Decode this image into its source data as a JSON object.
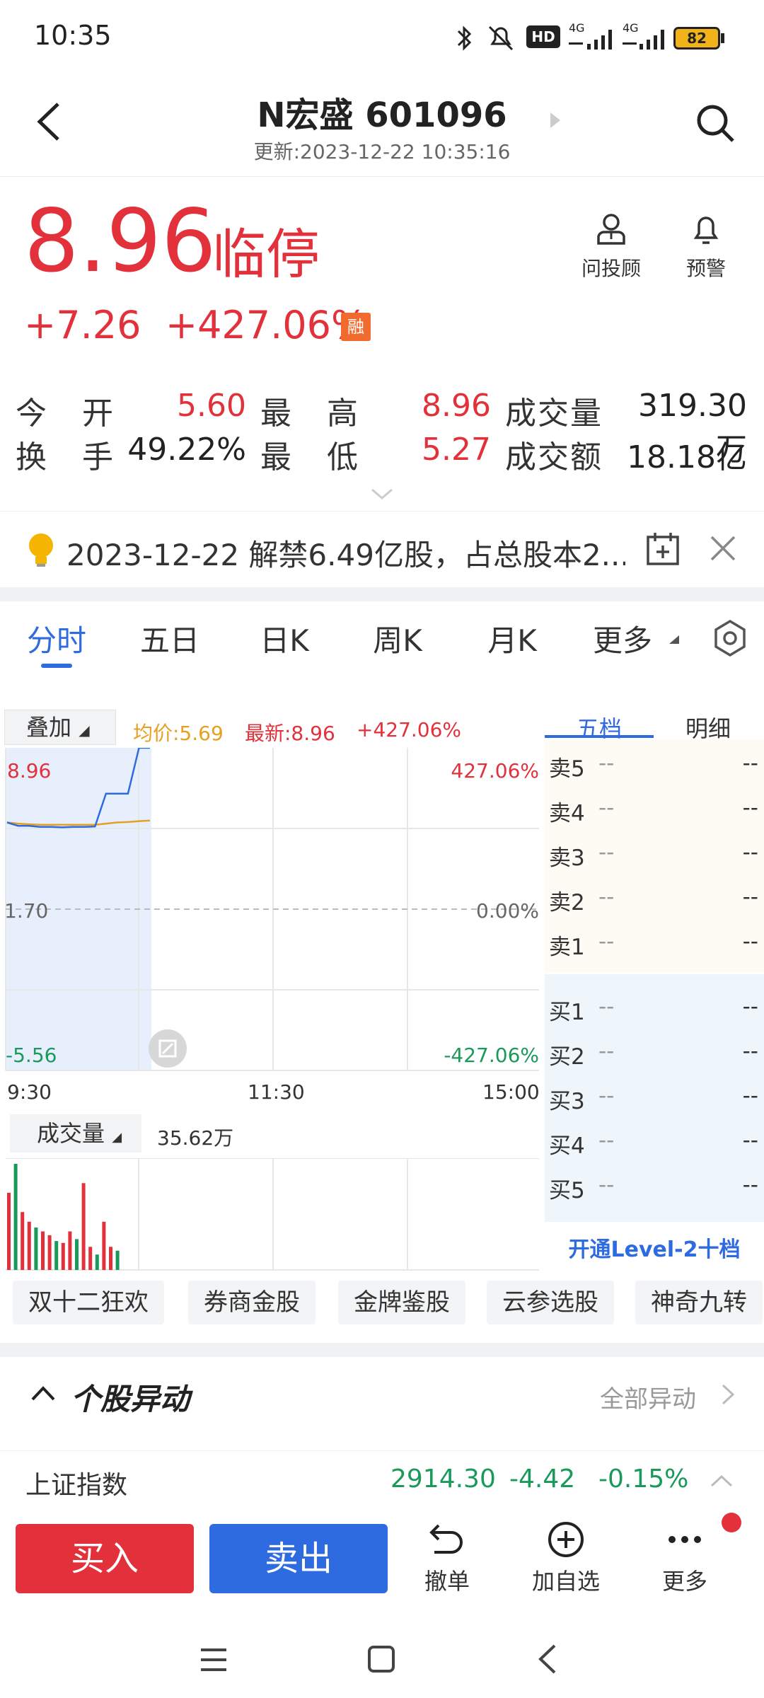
{
  "status": {
    "time": "10:35",
    "battery": "82",
    "hd": "HD",
    "net1": "4G",
    "net2": "4G"
  },
  "header": {
    "title": "N宏盛 601096",
    "subtitle": "更新:2023-12-22 10:35:16"
  },
  "quote": {
    "price": "8.96",
    "state": "临停",
    "change": "+7.26",
    "change_pct": "+427.06%",
    "margin_badge": "融"
  },
  "tools": {
    "advisor": "问投顾",
    "alert": "预警"
  },
  "stats": {
    "open_label": "今 开",
    "open": "5.60",
    "high_label": "最 高",
    "high": "8.96",
    "vol_label": "成交量",
    "vol": "319.30万",
    "turnover_label": "换 手",
    "turnover": "49.22%",
    "low_label": "最 低",
    "low": "5.27",
    "amount_label": "成交额",
    "amount": "18.18亿"
  },
  "notice": {
    "text": "2023-12-22 解禁6.49亿股，占总股本2..."
  },
  "tabs": [
    "分时",
    "五日",
    "日K",
    "周K",
    "月K",
    "更多"
  ],
  "chart": {
    "overlay_label": "叠加",
    "avg": "均价:5.69",
    "latest": "最新:8.96",
    "latest_pct": "+427.06%",
    "y_top": "8.96",
    "y_mid": "1.70",
    "y_bot": "-5.56",
    "pct_top": "427.06%",
    "pct_mid": "0.00%",
    "pct_bot": "-427.06%",
    "x_labels": [
      "9:30",
      "11:30",
      "15:00"
    ],
    "volume_label": "成交量",
    "volume_value": "35.62万",
    "price_color": "#2f6be0",
    "avg_color": "#e6a020"
  },
  "chart_data": {
    "type": "line",
    "title": "",
    "x": [
      "9:30",
      "9:35",
      "9:40",
      "9:45",
      "9:50",
      "9:55",
      "10:00",
      "10:05",
      "10:10",
      "10:15",
      "10:20",
      "10:25",
      "10:30",
      "10:35"
    ],
    "series": [
      {
        "name": "最新",
        "values": [
          5.6,
          5.45,
          5.45,
          5.4,
          5.4,
          5.38,
          5.4,
          5.4,
          5.42,
          6.9,
          6.9,
          6.9,
          8.96,
          8.96
        ]
      },
      {
        "name": "均价",
        "values": [
          5.6,
          5.55,
          5.52,
          5.5,
          5.5,
          5.5,
          5.5,
          5.5,
          5.5,
          5.55,
          5.6,
          5.62,
          5.66,
          5.69
        ]
      }
    ],
    "ylim": [
      -5.56,
      8.96
    ],
    "volume": [
      40,
      55,
      30,
      25,
      22,
      20,
      18,
      15,
      14,
      20,
      16,
      45,
      12,
      8,
      25,
      12,
      10
    ],
    "legend": "none"
  },
  "orderbook": {
    "tabs": [
      "五档",
      "明细"
    ],
    "asks": [
      {
        "label": "卖5",
        "price": "--",
        "vol": "--"
      },
      {
        "label": "卖4",
        "price": "--",
        "vol": "--"
      },
      {
        "label": "卖3",
        "price": "--",
        "vol": "--"
      },
      {
        "label": "卖2",
        "price": "--",
        "vol": "--"
      },
      {
        "label": "卖1",
        "price": "--",
        "vol": "--"
      }
    ],
    "bids": [
      {
        "label": "买1",
        "price": "--",
        "vol": "--"
      },
      {
        "label": "买2",
        "price": "--",
        "vol": "--"
      },
      {
        "label": "买3",
        "price": "--",
        "vol": "--"
      },
      {
        "label": "买4",
        "price": "--",
        "vol": "--"
      },
      {
        "label": "买5",
        "price": "--",
        "vol": "--"
      }
    ],
    "level2": "开通Level-2十档"
  },
  "chips": [
    "双十二狂欢",
    "券商金股",
    "金牌鉴股",
    "云参选股",
    "神奇九转"
  ],
  "anomaly": {
    "title": "个股异动",
    "all": "全部异动"
  },
  "index": {
    "name": "上证指数",
    "value": "2914.30",
    "change": "-4.42",
    "pct": "-0.15%"
  },
  "bottom": {
    "buy": "买入",
    "sell": "卖出",
    "cancel": "撤单",
    "watch": "加自选",
    "more": "更多"
  }
}
